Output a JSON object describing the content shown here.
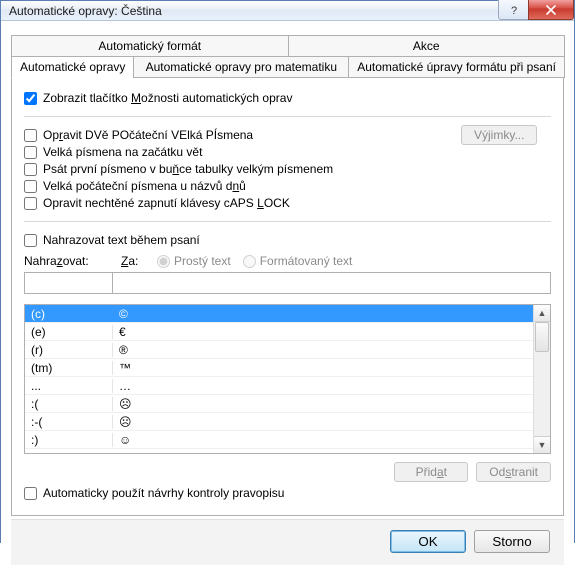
{
  "window": {
    "title": "Automatické opravy: Čeština"
  },
  "topTabs": {
    "left": "Automatický formát",
    "right": "Akce"
  },
  "subTabs": {
    "a": "Automatické opravy",
    "b": "Automatické opravy pro matematiku",
    "c": "Automatické úpravy formátu při psaní"
  },
  "checks": {
    "showBtn_pre": "Zobrazit tlačítko ",
    "showBtn_u": "M",
    "showBtn_post": "ožnosti automatických oprav",
    "twoCaps_pre": "Op",
    "twoCaps_u": "r",
    "twoCaps_post": "avit DVě POčáteční VElká PÍsmena",
    "sentence": "Velká písmena na začátku vět",
    "tableCell_pre": "Psát první písmeno v bu",
    "tableCell_u": "ň",
    "tableCell_post": "ce tabulky velkým písmenem",
    "dayNames_pre": "Velká počáteční písmena u názvů d",
    "dayNames_u": "n",
    "dayNames_post": "ů",
    "capslock_pre": "Opravit nechtěné zapnutí klávesy cAPS ",
    "capslock_u": "L",
    "capslock_post": "OCK"
  },
  "exceptionsBtn": "Výjimky...",
  "replaceWhileTyping": "Nahrazovat text během psaní",
  "replaceLabel_pre": "Nahra",
  "replaceLabel_u": "z",
  "replaceLabel_post": "ovat:",
  "withLabel_u": "Z",
  "withLabel_post": "a:",
  "radioPlain": "Prostý text",
  "radioFormatted": "Formátovaný text",
  "list": [
    {
      "from": "(c)",
      "to": "©"
    },
    {
      "from": "(e)",
      "to": "€"
    },
    {
      "from": "(r)",
      "to": "®"
    },
    {
      "from": "(tm)",
      "to": "™"
    },
    {
      "from": "...",
      "to": "…"
    },
    {
      "from": ":(",
      "to": "☹"
    },
    {
      "from": ":-(",
      "to": "☹"
    },
    {
      "from": ":)",
      "to": "☺"
    }
  ],
  "addBtn_pre": "Přid",
  "addBtn_u": "a",
  "addBtn_post": "t",
  "deleteBtn_pre": "Od",
  "deleteBtn_u": "s",
  "deleteBtn_post": "tranit",
  "suggestions": "Automaticky použít návrhy kontroly pravopisu",
  "ok": "OK",
  "cancel": "Storno"
}
